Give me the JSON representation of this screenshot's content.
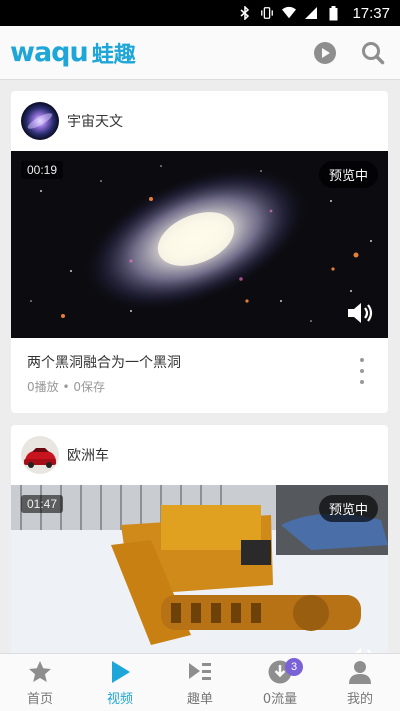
{
  "status_bar": {
    "time": "17:37",
    "icons": [
      "bluetooth-icon",
      "vibrate-icon",
      "wifi-icon",
      "cellular-signal-icon",
      "battery-icon"
    ]
  },
  "app_bar": {
    "logo_latin": "waqu",
    "logo_chinese": "蛙趣",
    "brand_color": "#1fa6d9",
    "actions": [
      "play-icon",
      "search-icon"
    ]
  },
  "feed": {
    "videos": [
      {
        "channel": "宇宙天文",
        "duration": "00:19",
        "preview_label": "预览中",
        "title": "两个黑洞融合为一个黑洞",
        "meta": "0播放 • 0保存"
      },
      {
        "channel": "欧洲车",
        "duration": "01:47",
        "preview_label": "预览中"
      }
    ]
  },
  "bottom_nav": {
    "items": [
      {
        "label": "首页",
        "icon": "star-icon"
      },
      {
        "label": "视频",
        "icon": "play-triangle-icon",
        "active": true
      },
      {
        "label": "趣单",
        "icon": "playlist-icon"
      },
      {
        "label": "0流量",
        "icon": "download-icon",
        "badge": "3"
      },
      {
        "label": "我的",
        "icon": "person-icon"
      }
    ]
  }
}
